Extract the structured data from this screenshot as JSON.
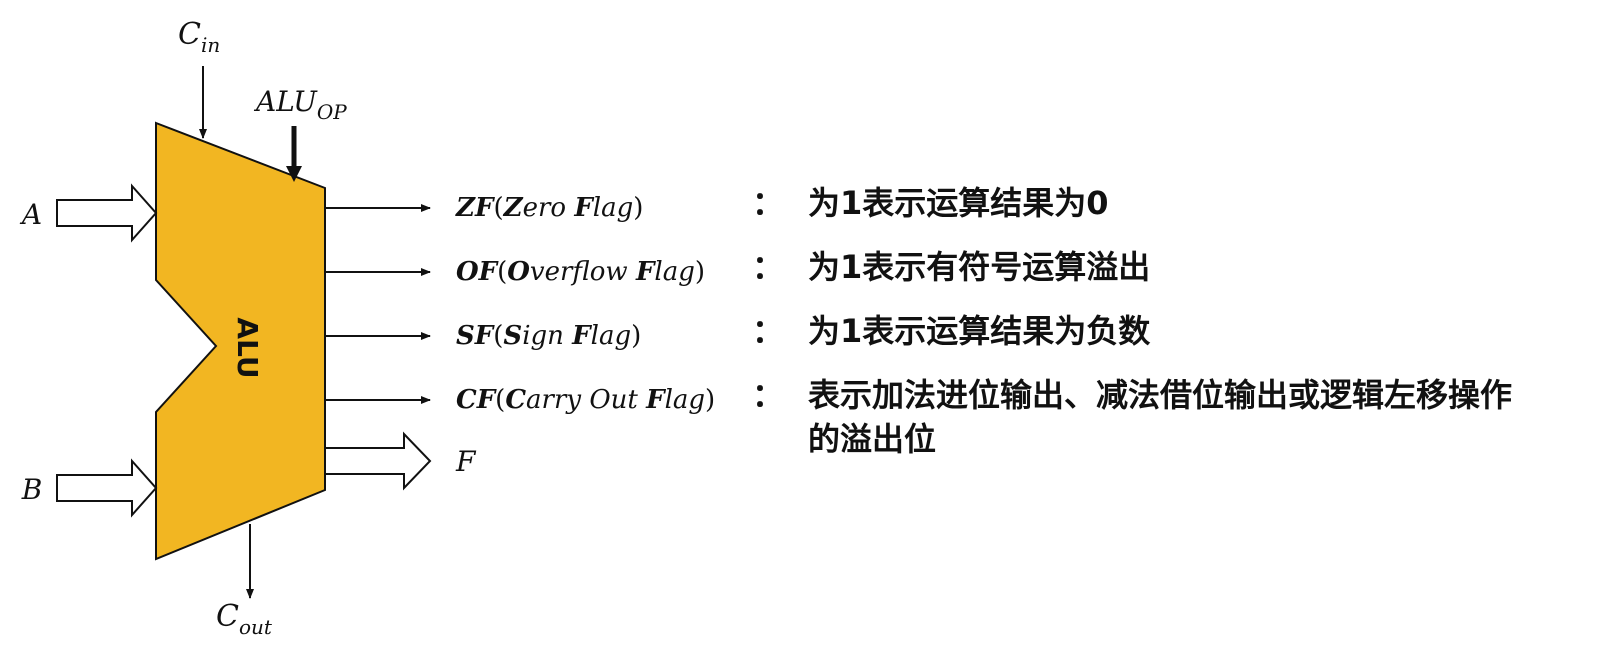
{
  "alu": {
    "label": "ALU",
    "fill_color": "#F2B622"
  },
  "inputs": {
    "a": "A",
    "b": "B",
    "cin_main": "C",
    "cin_sub": "in",
    "aluop_main": "ALU",
    "aluop_sub": "OP",
    "cout_main": "C",
    "cout_sub": "out"
  },
  "outputs": [
    {
      "abbr": "ZF",
      "open": "(",
      "w1_initial": "Z",
      "w1_rest": "ero ",
      "w2_initial": "F",
      "w2_rest": "lag",
      "w3_initial": "",
      "w3_rest": "",
      "close": ")",
      "colon": "：",
      "desc": [
        "为1表示运算结果为0"
      ]
    },
    {
      "abbr": "OF",
      "open": "(",
      "w1_initial": "O",
      "w1_rest": "verflow ",
      "w2_initial": "F",
      "w2_rest": "lag",
      "w3_initial": "",
      "w3_rest": "",
      "close": ")",
      "colon": "：",
      "desc": [
        "为1表示有符号运算溢出"
      ]
    },
    {
      "abbr": "SF",
      "open": "(",
      "w1_initial": "S",
      "w1_rest": "ign ",
      "w2_initial": "F",
      "w2_rest": "lag",
      "w3_initial": "",
      "w3_rest": "",
      "close": ")",
      "colon": "：",
      "desc": [
        "为1表示运算结果为负数"
      ]
    },
    {
      "abbr": "CF",
      "open": "(",
      "w1_initial": "C",
      "w1_rest": "arry Out ",
      "w2_initial": "F",
      "w2_rest": "lag",
      "w3_initial": "",
      "w3_rest": "",
      "close": ")",
      "colon": "：",
      "desc": [
        "表示加法进位输出、减法借位输出或逻辑左移操作",
        "的溢出位"
      ]
    }
  ],
  "result": {
    "label": "F"
  }
}
